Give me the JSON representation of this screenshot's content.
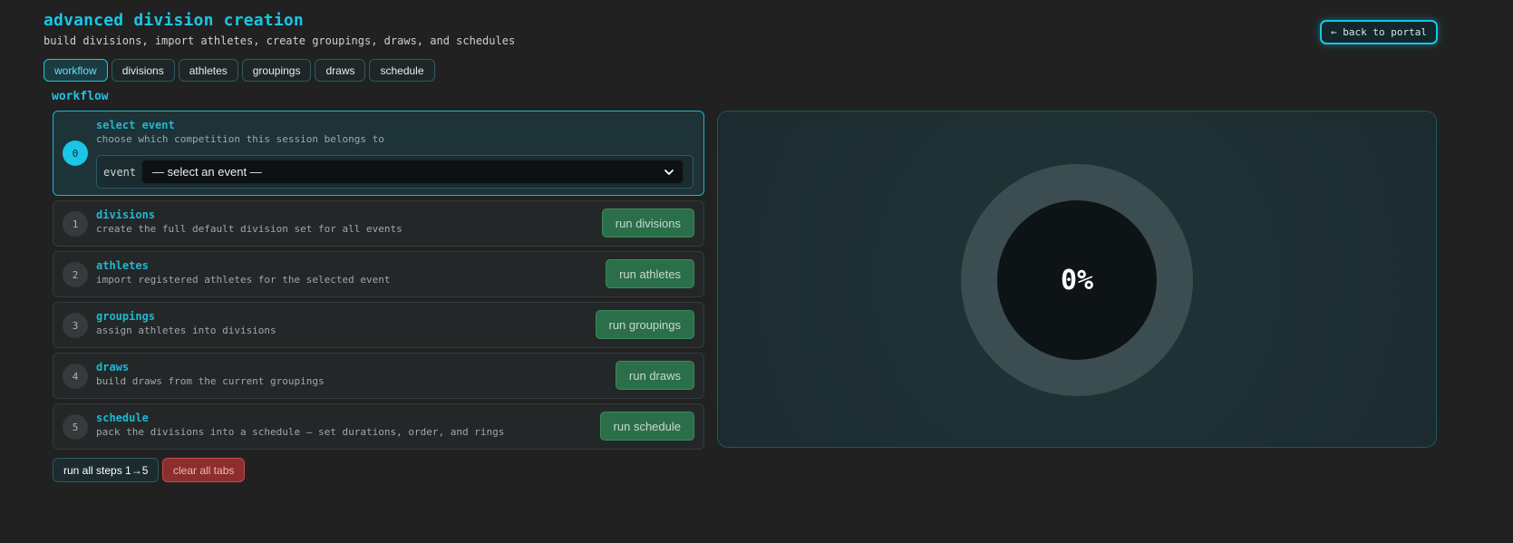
{
  "header": {
    "title": "advanced division creation",
    "subtitle": "build divisions, import athletes, create groupings, draws, and schedules",
    "back_button": "← back to portal"
  },
  "tabs": [
    {
      "label": "workflow",
      "active": true
    },
    {
      "label": "divisions",
      "active": false
    },
    {
      "label": "athletes",
      "active": false
    },
    {
      "label": "groupings",
      "active": false
    },
    {
      "label": "draws",
      "active": false
    },
    {
      "label": "schedule",
      "active": false
    }
  ],
  "workflow": {
    "title": "workflow",
    "steps": [
      {
        "number": "0",
        "name": "select event",
        "description": "choose which competition this session belongs to",
        "event_label": "event",
        "event_selected": "— select an event —"
      },
      {
        "number": "1",
        "name": "divisions",
        "description": "create the full default division set for all events",
        "button": "run divisions"
      },
      {
        "number": "2",
        "name": "athletes",
        "description": "import registered athletes for the selected event",
        "button": "run athletes"
      },
      {
        "number": "3",
        "name": "groupings",
        "description": "assign athletes into divisions",
        "button": "run groupings"
      },
      {
        "number": "4",
        "name": "draws",
        "description": "build draws from the current groupings",
        "button": "run draws"
      },
      {
        "number": "5",
        "name": "schedule",
        "description": "pack the divisions into a schedule — set durations, order, and rings",
        "button": "run schedule"
      }
    ],
    "run_all_button": "run all steps 1→5",
    "clear_button": "clear all tabs"
  },
  "progress": {
    "value": 0,
    "label": "0%"
  },
  "colors": {
    "accent": "#19c6e6",
    "run_button": "#2a6f49",
    "danger": "#8b2e2c",
    "background": "#212121"
  }
}
